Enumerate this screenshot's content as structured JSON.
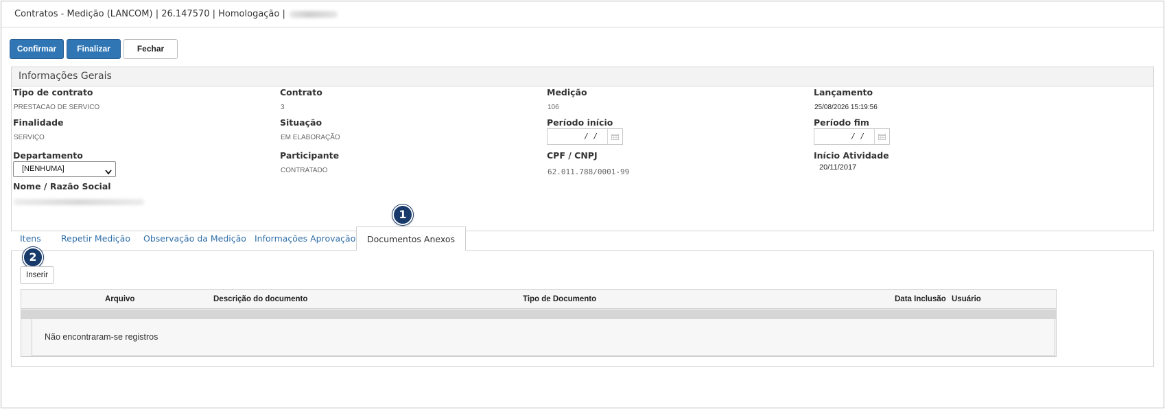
{
  "window": {
    "title": "Contratos - Medição (LANCOM) | 26.147570 | Homologação |"
  },
  "toolbar": {
    "confirm_label": "Confirmar",
    "finalize_label": "Finalizar",
    "close_label": "Fechar"
  },
  "general_info": {
    "heading": "Informações Gerais",
    "fields": {
      "tipo_contrato": {
        "label": "Tipo de contrato",
        "value": "PRESTACAO DE SERVICO"
      },
      "contrato": {
        "label": "Contrato",
        "value": "3"
      },
      "medicao": {
        "label": "Medição",
        "value": "106"
      },
      "lancamento": {
        "label": "Lançamento",
        "value": "25/08/2026 15:19:56"
      },
      "finalidade": {
        "label": "Finalidade",
        "value": "SERVIÇO"
      },
      "situacao": {
        "label": "Situação",
        "value": "EM ELABORAÇÃO"
      },
      "periodo_inicio": {
        "label": "Período início",
        "value": "/ /"
      },
      "periodo_fim": {
        "label": "Período fim",
        "value": "/ /"
      },
      "departamento": {
        "label": "Departamento",
        "value": "[NENHUMA]"
      },
      "participante": {
        "label": "Participante",
        "value": "CONTRATADO"
      },
      "cpf_cnpj": {
        "label": "CPF / CNPJ",
        "value": "62.011.788/0001-99"
      },
      "inicio_atividade": {
        "label": "Início Atividade",
        "value": "20/11/2017"
      },
      "nome_razao": {
        "label": "Nome / Razão Social"
      }
    }
  },
  "tabs": [
    {
      "label": "Itens"
    },
    {
      "label": "Repetir Medição"
    },
    {
      "label": "Observação da Medição"
    },
    {
      "label": "Informações Aprovação"
    },
    {
      "label": "Documentos Anexos",
      "active": true
    }
  ],
  "markers": {
    "one": "1",
    "two": "2"
  },
  "documents": {
    "insert_label": "Inserir",
    "columns": [
      "Arquivo",
      "Descrição do documento",
      "Tipo de Documento",
      "Data Inclusão",
      "Usuário"
    ],
    "empty_message": "Não encontraram-se registros"
  },
  "colors": {
    "primary": "#3076b5",
    "link": "#2f6ea8",
    "marker": "#173a6b"
  }
}
